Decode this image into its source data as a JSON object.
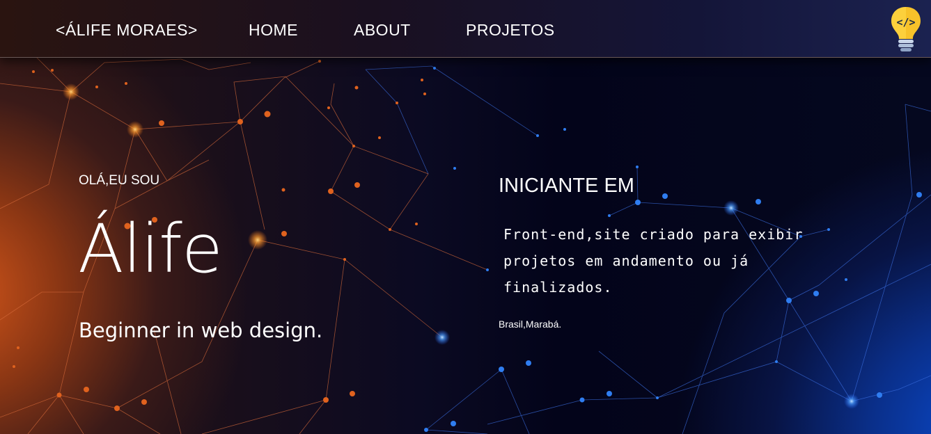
{
  "nav": {
    "brand": "<ÁLIFE MORAES>",
    "links": [
      "HOME",
      "ABOUT",
      "PROJETOS"
    ],
    "logo_icon": "lightbulb-code-icon"
  },
  "hero": {
    "greeting": "OLÁ,EU SOU",
    "name": "Álife",
    "tagline": "Beginner in web design.",
    "heading": "INICIANTE EM",
    "description": "Front-end,site criado para exibir projetos em andamento ou já finalizados.",
    "location": "Brasil,Marabá."
  },
  "colors": {
    "warm_accent": "#e0621e",
    "cool_accent": "#2a7bf0",
    "background": "#05061a",
    "bulb_yellow": "#f7c22a"
  }
}
